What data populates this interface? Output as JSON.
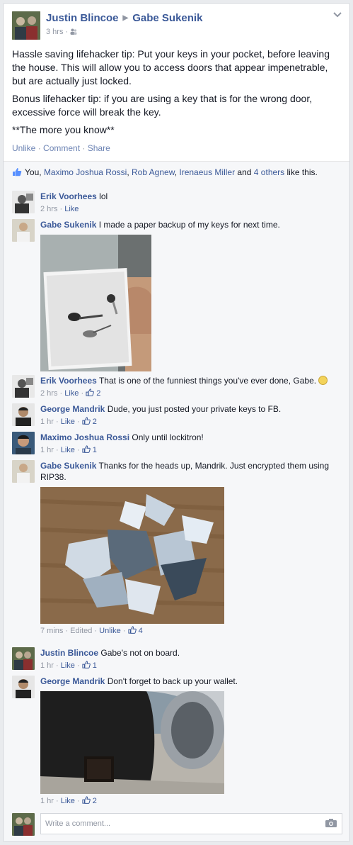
{
  "post": {
    "author": "Justin Blincoe",
    "target": "Gabe Sukenik",
    "time": "3 hrs",
    "paragraphs": [
      "Hassle saving lifehacker tip: Put your keys in your pocket, before leaving the house. This will allow you to access doors that appear impenetrable, but are actually just locked.",
      "Bonus lifehacker tip: if you are using a key that is for the wrong door, excessive force will break the key.",
      "**The more you know**"
    ],
    "actions": {
      "unlike": "Unlike",
      "comment": "Comment",
      "share": "Share",
      "sep": "·"
    }
  },
  "likes": {
    "prefix": "You,",
    "people": [
      "Maximo Joshua Rossi",
      "Rob Agnew",
      "Irenaeus Miller"
    ],
    "and": "and",
    "others": "4 others",
    "suffix": "like this."
  },
  "comments": [
    {
      "name": "Erik Voorhees",
      "text": "lol",
      "time": "2 hrs",
      "like": "Like",
      "likes": ""
    },
    {
      "name": "Gabe Sukenik",
      "text": "I made a paper backup of my keys for next time.",
      "time": "",
      "like": "",
      "likes": ""
    },
    {
      "name": "Erik Voorhees",
      "text": "That is one of the funniest things you've ever done, Gabe.",
      "time": "2 hrs",
      "like": "Like",
      "likes": "2"
    },
    {
      "name": "George Mandrik",
      "text": "Dude, you just posted your private keys to FB.",
      "time": "1 hr",
      "like": "Like",
      "likes": "2"
    },
    {
      "name": "Maximo Joshua Rossi",
      "text": "Only until lockitron!",
      "time": "1 hr",
      "like": "Like",
      "likes": "1"
    },
    {
      "name": "Gabe Sukenik",
      "text": "Thanks for the heads up, Mandrik. Just encrypted them using RIP38.",
      "time": "7 mins · Edited",
      "like": "Unlike",
      "likes": "4"
    },
    {
      "name": "Justin Blincoe",
      "text": "Gabe's not on board.",
      "time": "1 hr",
      "like": "Like",
      "likes": "1"
    },
    {
      "name": "George Mandrik",
      "text": "Don't forget to back up your wallet.",
      "time": "1 hr",
      "like": "Like",
      "likes": "2"
    }
  ],
  "composer": {
    "placeholder": "Write a comment..."
  },
  "colors": {
    "link": "#3b5998",
    "muted": "#9197a3",
    "bg": "#f6f7f9"
  },
  "icons": [
    "chevron-down-icon",
    "friends-audience-icon",
    "thumbs-up-icon",
    "smiley-emoticon-icon",
    "camera-icon"
  ]
}
